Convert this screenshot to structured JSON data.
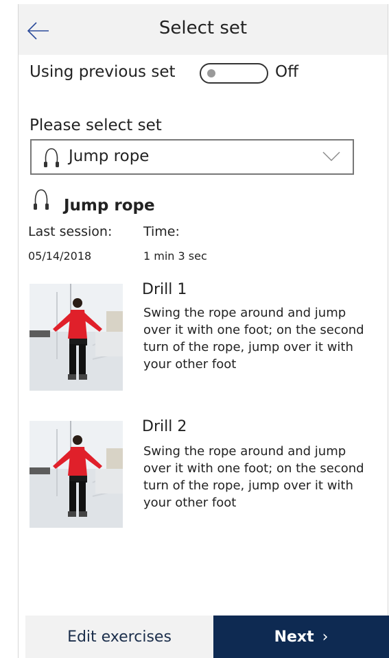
{
  "header": {
    "title": "Select set",
    "back_icon": "back-arrow-icon"
  },
  "toggle": {
    "label": "Using previous set",
    "state_text": "Off",
    "on": false
  },
  "selector": {
    "label": "Please select set",
    "selected": "Jump rope",
    "icon": "jump-rope-icon"
  },
  "set": {
    "name": "Jump rope",
    "last_session_label": "Last session:",
    "last_session_value": "05/14/2018",
    "time_label": "Time:",
    "time_value": "1 min 3 sec"
  },
  "drills": [
    {
      "title": "Drill 1",
      "description": "Swing the rope around and jump over it with one foot; on the second turn of the rope, jump over it with your other foot"
    },
    {
      "title": "Drill 2",
      "description": "Swing the rope around and jump over it with one foot; on the second turn of the rope, jump over it with your other foot"
    }
  ],
  "footer": {
    "edit_label": "Edit exercises",
    "next_label": "Next"
  },
  "colors": {
    "primary": "#0e2a52",
    "header_bg": "#f2f2f2",
    "shirt": "#e0202a"
  }
}
